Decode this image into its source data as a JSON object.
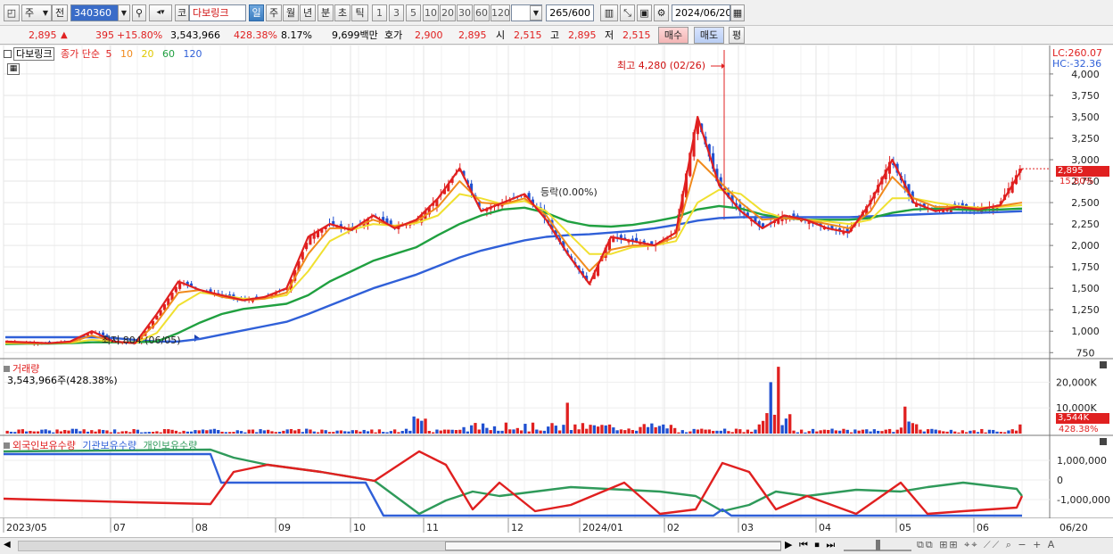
{
  "toolbar": {
    "market_tab": "주",
    "prev_label": "전",
    "stock_code": "340360",
    "stock_prefix": "코",
    "stock_name": "다보링크",
    "periods": [
      "일",
      "주",
      "월",
      "년",
      "분",
      "초",
      "틱"
    ],
    "active_period": "일",
    "intervals": [
      "1",
      "3",
      "5",
      "10",
      "20",
      "30",
      "60",
      "120"
    ],
    "count_value": "265",
    "count_total": "/600",
    "date_value": "2024/06/20"
  },
  "quote": {
    "price": "2,895",
    "change_arrow": "▲",
    "change": "395",
    "change_pct": "+15.80%",
    "volume": "3,543,966",
    "volume_ratio": "428.38%",
    "turnover": "8.17%",
    "amount": "9,699백만",
    "bid_label": "호가",
    "bid_value": "2,900",
    "bid_value2": "2,895",
    "open_label": "시",
    "open_value": "2,515",
    "high_label": "고",
    "high_value": "2,895",
    "low_label": "저",
    "low_value": "2,515",
    "buy_label": "매수",
    "sell_label": "매도",
    "avg_label": "평"
  },
  "legend": {
    "title": "다보링크",
    "text": "종가 단순",
    "periods": [
      "5",
      "10",
      "20",
      "60",
      "120"
    ]
  },
  "lc_hc": {
    "lc": "LC:260.07",
    "hc": "HC:-32.36"
  },
  "price_axis": {
    "ticks": [
      "4,000",
      "3,750",
      "3,500",
      "3,250",
      "3,000",
      "2,750",
      "2,500",
      "2,250",
      "2,000",
      "1,750",
      "1,500",
      "1,250",
      "1,000",
      "750"
    ],
    "tick_values": [
      4000,
      3750,
      3500,
      3250,
      3000,
      2750,
      2500,
      2250,
      2000,
      1750,
      1500,
      1250,
      1000,
      750
    ],
    "current_label": "2,895",
    "current_pct": "15.80%"
  },
  "annotations": {
    "high": "최고 4,280 (02/26)",
    "low": "최저 804 (06/05)",
    "updown": "등락(0.00%)"
  },
  "volume_panel": {
    "title": "거래량",
    "info": "3,543,966주(428.38%)",
    "ticks": [
      "20,000K",
      "10,000K"
    ],
    "current_label": "3,544K",
    "current_pct": "428.38%"
  },
  "holding_panel": {
    "legend": [
      "외국인보유수량",
      "기관보유수량",
      "개인보유수량"
    ],
    "ticks": [
      "1,000,000",
      "0",
      "-1,000,000"
    ]
  },
  "x_axis": {
    "labels": [
      "2023/05",
      "07",
      "08",
      "09",
      "10",
      "11",
      "12",
      "2024/01",
      "02",
      "03",
      "04",
      "05",
      "06"
    ],
    "end_label": "06/20"
  },
  "colors": {
    "up": "#e02020",
    "down": "#2050d0",
    "ma5": "#e02020",
    "ma10": "#f08a1c",
    "ma20": "#f0e030",
    "ma60": "#20a040",
    "ma120": "#3060d8",
    "foreign": "#e02020",
    "institution": "#3060d8",
    "individual": "#2f9a5a"
  },
  "chart_data": {
    "type": "candlestick",
    "title": "다보링크",
    "x_range": [
      "2023/05",
      "2024/06/20"
    ],
    "ylim": [
      680,
      4280
    ],
    "high": {
      "value": 4280,
      "date": "02/26"
    },
    "low": {
      "value": 804,
      "date": "06/05"
    },
    "last_close": 2895,
    "series": [
      {
        "name": "5",
        "values": [
          880,
          870,
          860,
          880,
          1000,
          880,
          860,
          1200,
          1580,
          1480,
          1420,
          1360,
          1400,
          1500,
          2100,
          2250,
          2180,
          2350,
          2200,
          2300,
          2550,
          2900,
          2400,
          2500,
          2600,
          2300,
          1900,
          1550,
          2100,
          2050,
          2000,
          2150,
          3500,
          2700,
          2400,
          2200,
          2350,
          2300,
          2200,
          2150,
          2500,
          3000,
          2500,
          2400,
          2450,
          2420,
          2470,
          2895
        ]
      },
      {
        "name": "10",
        "values": [
          870,
          860,
          860,
          870,
          950,
          880,
          860,
          1100,
          1450,
          1480,
          1400,
          1360,
          1380,
          1450,
          1900,
          2200,
          2200,
          2300,
          2220,
          2280,
          2450,
          2750,
          2500,
          2480,
          2550,
          2350,
          2000,
          1700,
          1950,
          2000,
          2000,
          2100,
          3000,
          2750,
          2500,
          2300,
          2320,
          2300,
          2250,
          2200,
          2400,
          2800,
          2550,
          2450,
          2450,
          2430,
          2460,
          2500
        ]
      },
      {
        "name": "20",
        "values": [
          860,
          860,
          860,
          865,
          900,
          880,
          860,
          980,
          1300,
          1450,
          1420,
          1380,
          1380,
          1420,
          1700,
          2050,
          2180,
          2250,
          2230,
          2260,
          2350,
          2600,
          2550,
          2480,
          2520,
          2400,
          2150,
          1900,
          1900,
          1980,
          2000,
          2050,
          2500,
          2650,
          2600,
          2400,
          2320,
          2300,
          2280,
          2250,
          2300,
          2550,
          2550,
          2500,
          2460,
          2440,
          2450,
          2470
        ]
      },
      {
        "name": "60",
        "values": [
          850,
          855,
          855,
          860,
          870,
          870,
          870,
          880,
          980,
          1100,
          1200,
          1260,
          1290,
          1320,
          1420,
          1580,
          1700,
          1820,
          1900,
          1980,
          2120,
          2250,
          2350,
          2420,
          2440,
          2380,
          2280,
          2230,
          2220,
          2240,
          2280,
          2330,
          2420,
          2460,
          2430,
          2360,
          2320,
          2300,
          2300,
          2300,
          2320,
          2380,
          2420,
          2430,
          2420,
          2410,
          2420,
          2430
        ]
      },
      {
        "name": "120",
        "values": [
          930,
          930,
          930,
          930,
          930,
          920,
          900,
          880,
          880,
          910,
          960,
          1010,
          1060,
          1110,
          1200,
          1300,
          1400,
          1500,
          1580,
          1660,
          1760,
          1860,
          1940,
          2000,
          2060,
          2100,
          2120,
          2130,
          2150,
          2170,
          2200,
          2240,
          2290,
          2320,
          2330,
          2330,
          2330,
          2330,
          2330,
          2330,
          2340,
          2350,
          2360,
          2370,
          2380,
          2380,
          2390,
          2400
        ]
      }
    ]
  }
}
